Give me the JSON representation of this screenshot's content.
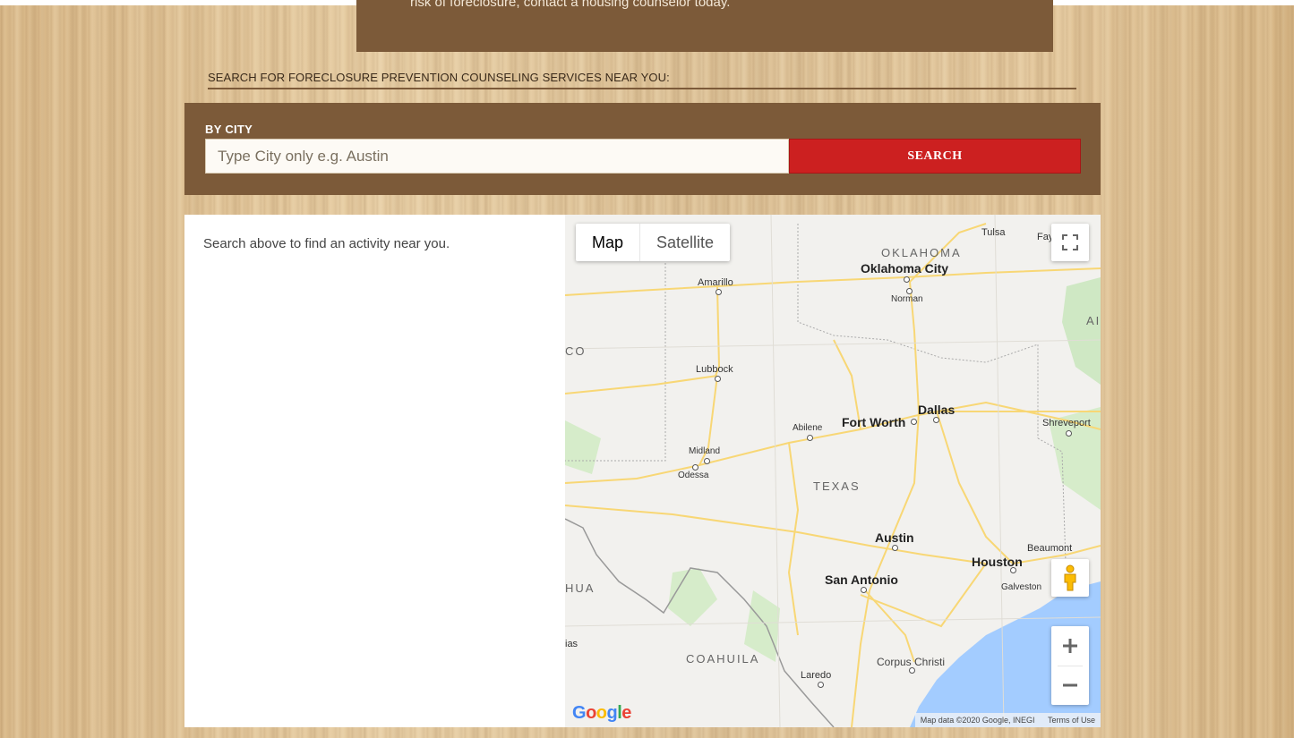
{
  "banner": {
    "text": "risk of foreclosure, contact a housing counselor today."
  },
  "search": {
    "heading": "SEARCH FOR FORECLOSURE PREVENTION COUNSELING SERVICES NEAR YOU:",
    "by_city_label": "BY CITY",
    "placeholder": "Type City only e.g. Austin",
    "button_label": "SEARCH"
  },
  "results": {
    "message": "Search above to find an activity near you."
  },
  "map": {
    "type_controls": {
      "map": "Map",
      "satellite": "Satellite"
    },
    "cities": {
      "tulsa": "Tulsa",
      "fayetteville": "Fayett",
      "oklahoma_city": "Oklahoma City",
      "norman": "Norman",
      "amarillo": "Amarillo",
      "lubbock": "Lubbock",
      "dallas": "Dallas",
      "fort_worth": "Fort Worth",
      "abilene": "Abilene",
      "shreveport": "Shreveport",
      "midland": "Midland",
      "odessa": "Odessa",
      "austin": "Austin",
      "beaumont": "Beaumont",
      "houston": "Houston",
      "galveston": "Galveston",
      "san_antonio": "San Antonio",
      "corpus_christi": "Corpus Christi",
      "laredo": "Laredo"
    },
    "regions": {
      "oklahoma": "OKLAHOMA",
      "texas": "TEXAS",
      "coahuila": "COAHUILA",
      "new_mexico_partial": "CO",
      "chihuahua_partial": "HUA",
      "arkansas_partial": "AI",
      "partial_left": "ias"
    },
    "google_logo": "Google",
    "attribution": "Map data ©2020 Google, INEGI",
    "terms": "Terms of Use",
    "colors": {
      "water": "#a3ccff",
      "land": "#f2f1ee",
      "park": "#cfe8c4",
      "highway": "#f8d775"
    }
  }
}
